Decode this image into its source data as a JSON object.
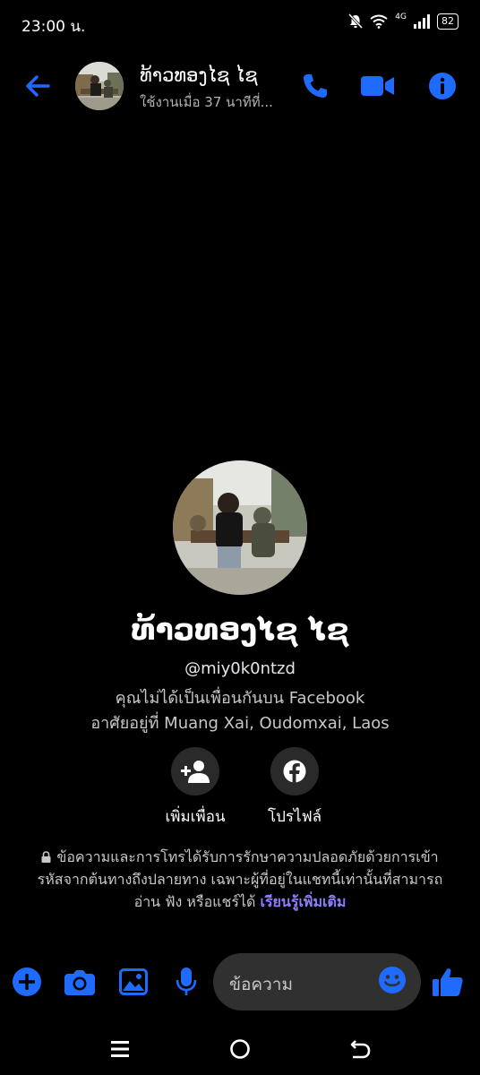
{
  "status_bar": {
    "time": "23:00 น.",
    "network": "4G",
    "battery": "82"
  },
  "header": {
    "name": "ທ້າວທອງໄຊ ໄຊ",
    "status": "ใช้งานเมื่อ 37 นาทีที่..."
  },
  "profile": {
    "name": "ທ້າວທອງໄຊ ໄຊ",
    "username": "@miy0k0ntzd",
    "friend_note": "คุณไม่ได้เป็นเพื่อนกันบน Facebook",
    "lives_in": "อาศัยอยู่ที่ Muang Xai, Oudomxai, Laos"
  },
  "actions": {
    "add_friend": "เพิ่มเพื่อน",
    "profile": "โปรไฟล์"
  },
  "e2ee": {
    "text": "ข้อความและการโทรได้รับการรักษาความปลอดภัยด้วยการเข้ารหัสจากต้นทางถึงปลายทาง เฉพาะผู้ที่อยู่ในแชทนี้เท่านั้นที่สามารถอ่าน ฟัง หรือแชร์ได้ ",
    "link": "เรียนรู้เพิ่มเติม"
  },
  "composer": {
    "placeholder": "ข้อความ"
  },
  "colors": {
    "accent": "#1f6bff",
    "link": "#8d7dff",
    "background": "#000000"
  },
  "icons": [
    "back-arrow-icon",
    "phone-icon",
    "video-camera-icon",
    "info-icon",
    "add-person-icon",
    "facebook-icon",
    "lock-icon",
    "plus-icon",
    "camera-icon",
    "image-icon",
    "microphone-icon",
    "emoji-icon",
    "thumbs-up-icon",
    "menu-icon",
    "home-icon",
    "back-icon"
  ]
}
